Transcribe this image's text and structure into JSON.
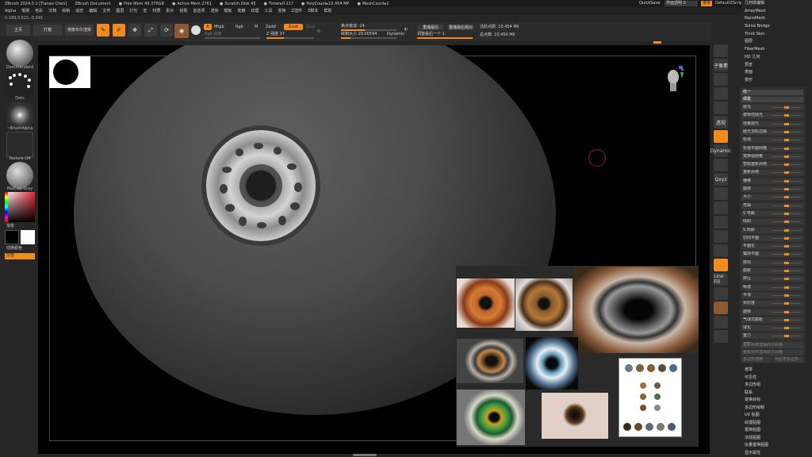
{
  "titlebar": {
    "app": "ZBrush 2024.0.1 [Tianao Chen]",
    "doc": "ZBrush Document",
    "free_mem": "Free Mem 49.376GB",
    "active_mem": "Active Mem 2761",
    "scratch": "Scratch Disk 45",
    "timer": "Timer▸0.117",
    "polycount": "PolyCount▸10.454 MP",
    "meshcount": "MeshCount▸1",
    "quicksave": "QuickSave",
    "transparency": "界面透明 0",
    "menus_btn": "菜单",
    "script": "DefaultZScript"
  },
  "menubar": [
    "Alpha",
    "笔刷",
    "色彩",
    "文档",
    "绘制",
    "动态",
    "编辑",
    "文件",
    "图层",
    "灯光",
    "宏",
    "材质",
    "影片",
    "拾取",
    "首选项",
    "渲染",
    "模板",
    "笔触",
    "纹理",
    "工具",
    "变换",
    "Z插件",
    "Z脚本",
    "帮助"
  ],
  "coords": "0.189,0.615,-0.345",
  "topctrl": {
    "home": "主页",
    "lightbox": "灯箱",
    "live_boolean": "镜像布尔渲染",
    "tools": [
      "Edit",
      "Draw",
      "Move",
      "Scale",
      "Rotate"
    ],
    "a_btn": "A",
    "mrgb": "Mrgb",
    "rgb": "Rgb",
    "m": "M",
    "zadd": "Zadd",
    "zsub": "Zsub",
    "zcut": "Zcut",
    "rgb_intensity": "Rgb 强度",
    "z_intensity": "Z 强度 37",
    "focal_shift": "焦点衰减 -14",
    "draw_size": "绘制大小 29.00594",
    "dynamic": "Dynamic",
    "active_points": "活跃点数: 10.454 Mil",
    "total_points": "总点数: 10.454 Mil",
    "replay_last": "重播最后",
    "replay_last_rel": "重播最后相对",
    "spotlight": "调整最后一个 1"
  },
  "leftshelf": {
    "brush": "DamStandard",
    "stroke": "Dots",
    "alpha": "~BrushAlpha",
    "texture": "Texture Off",
    "material": "MatCap Gray",
    "gradient": "渐变",
    "switch_color": "切换颜色",
    "alternate": "交替"
  },
  "rightstrip": [
    "",
    "子像素",
    "",
    "",
    "",
    "透视",
    "",
    "Dynamic",
    "",
    "Qxyz",
    "",
    "",
    "",
    "",
    "",
    "",
    "Line Fill",
    "",
    "",
    "",
    ""
  ],
  "submenu": [
    "几何体编辑",
    "ArrayMesh",
    "NanoMesh",
    "Slime Bridge",
    "Thick Skin",
    "图层",
    "FiberMesh",
    "HD 几何",
    "预览",
    "表面",
    "变形"
  ],
  "palette": {
    "header": "统一",
    "header2": "细置",
    "rows": [
      "抛光",
      "按特性抛光",
      "增量抛光",
      "抛光顶轮边缘",
      "松弛",
      "松弛平面网格",
      "变换视网格",
      "智能重新对称",
      "重新对称",
      "偏移",
      "旋转",
      "大小",
      "弯曲",
      "S 弯曲",
      "倾斜",
      "S 倾斜",
      "切向平面",
      "平面化",
      "镇块平面",
      "挤出",
      "膨胀",
      "挤压",
      "噪波",
      "平滑",
      "对比度",
      "旋转",
      "气球式膨胀",
      "球化",
      "重力",
      "透视"
    ],
    "footer1": "重新对称选择的子网格",
    "footer2": "重新对称选择的子网格",
    "footer3": "多边形倍数",
    "footer4": "对应中多边形"
  },
  "lowermenu": [
    "遮罩",
    "可见性",
    "多边形组",
    "联系",
    "变换目标",
    "多边形绘制",
    "UV 贴图",
    "纹理贴图",
    "置换贴图",
    "法线贴图",
    "矢量置换贴图",
    "显示属性"
  ],
  "colors": {
    "accent": "#f08b22",
    "bg": "#262626",
    "viewport": "#000000"
  }
}
